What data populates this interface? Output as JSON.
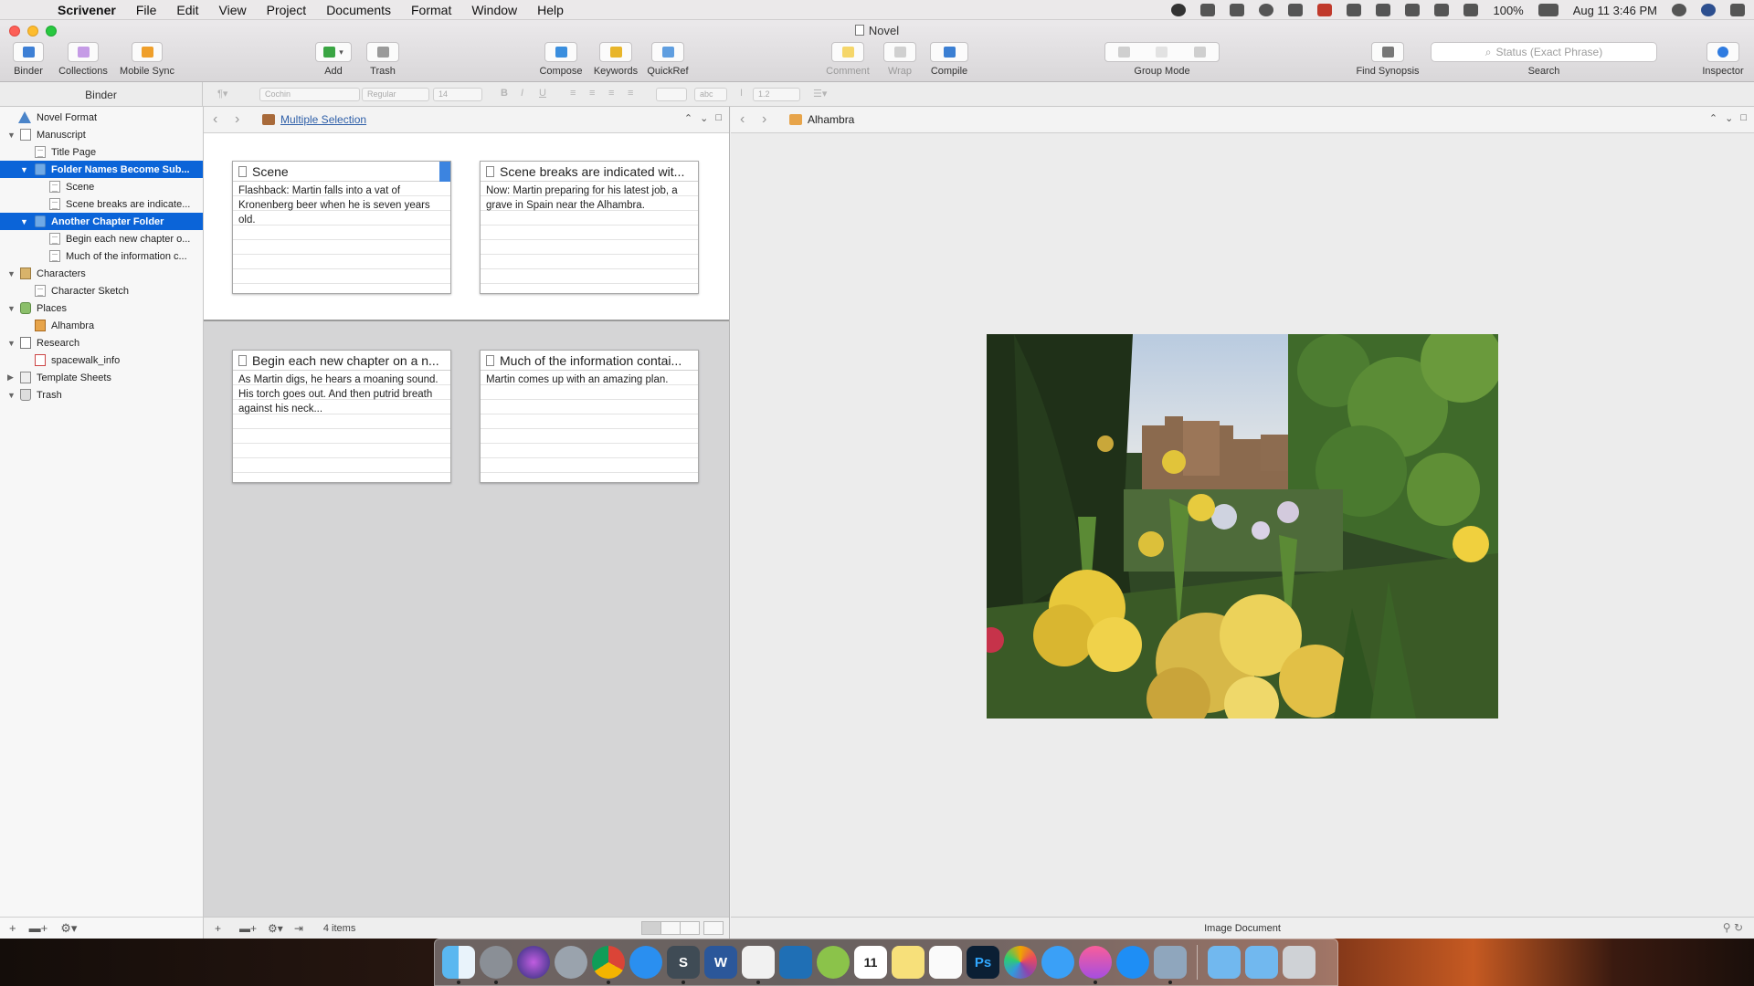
{
  "menubar": {
    "app": "Scrivener",
    "items": [
      "File",
      "Edit",
      "View",
      "Project",
      "Documents",
      "Format",
      "Window",
      "Help"
    ],
    "battery": "100%",
    "clock": "Aug 11  3:46 PM"
  },
  "window": {
    "title": "Novel"
  },
  "toolbar": {
    "binder": "Binder",
    "collections": "Collections",
    "mobile_sync": "Mobile Sync",
    "add": "Add",
    "trash": "Trash",
    "compose": "Compose",
    "keywords": "Keywords",
    "quickref": "QuickRef",
    "comment": "Comment",
    "wrap": "Wrap",
    "compile": "Compile",
    "group_mode": "Group Mode",
    "find_synopsis": "Find Synopsis",
    "search_placeholder": "Status (Exact Phrase)",
    "search_label": "Search",
    "inspector": "Inspector"
  },
  "formatbar": {
    "binder_header": "Binder",
    "font": "Cochin",
    "style": "Regular",
    "size": "14",
    "line_spacing": "1.2",
    "bold": "B",
    "italic": "I",
    "underline": "U",
    "highlight": "abc"
  },
  "binder": {
    "items": [
      {
        "label": "Novel Format"
      },
      {
        "label": "Manuscript"
      },
      {
        "label": "Title Page"
      },
      {
        "label": "Folder Names Become Sub..."
      },
      {
        "label": "Scene"
      },
      {
        "label": "Scene breaks are indicate..."
      },
      {
        "label": "Another Chapter Folder"
      },
      {
        "label": "Begin each new chapter o..."
      },
      {
        "label": "Much of the information c..."
      },
      {
        "label": "Characters"
      },
      {
        "label": "Character Sketch"
      },
      {
        "label": "Places"
      },
      {
        "label": "Alhambra"
      },
      {
        "label": "Research"
      },
      {
        "label": "spacewalk_info"
      },
      {
        "label": "Template Sheets"
      },
      {
        "label": "Trash"
      }
    ]
  },
  "left_editor": {
    "header_title": "Multiple Selection",
    "cards": [
      {
        "title": "Scene",
        "synopsis": "Flashback: Martin falls into a vat of Kronenberg beer when he is seven years old."
      },
      {
        "title": "Scene breaks are indicated wit...",
        "synopsis": "Now: Martin preparing for his latest job, a grave in Spain near the Alhambra."
      },
      {
        "title": "Begin each new chapter on a n...",
        "synopsis": "As Martin digs, he hears a moaning sound. His torch goes out. And then putrid breath against his neck..."
      },
      {
        "title": "Much of the information contai...",
        "synopsis": "Martin comes up with an amazing plan."
      }
    ],
    "footer_count": "4 items"
  },
  "right_editor": {
    "header_title": "Alhambra",
    "footer_label": "Image Document"
  },
  "dock": {
    "apps": [
      "finder-icon",
      "system-preferences-icon",
      "siri-icon",
      "launchpad-icon",
      "chrome-icon",
      "safari-icon",
      "scrivener-s-icon",
      "word-icon",
      "scrivener-icon",
      "remote-icon",
      "lime-icon",
      "calendar-icon",
      "notes-icon",
      "reminders-icon",
      "photoshop-icon",
      "photos-icon",
      "messages-icon",
      "itunes-icon",
      "app-store-icon",
      "preview-icon",
      "folder-icon",
      "downloads-icon",
      "trash-icon"
    ],
    "labels": {
      "word": "W",
      "photoshop": "Ps",
      "calendar_day": "11",
      "scrivener_s": "S"
    }
  }
}
